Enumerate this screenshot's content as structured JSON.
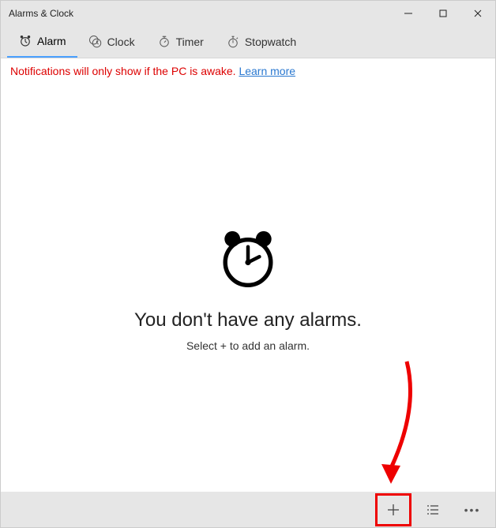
{
  "titlebar": {
    "title": "Alarms & Clock"
  },
  "tabs": [
    {
      "label": "Alarm",
      "icon": "alarm-icon",
      "active": true
    },
    {
      "label": "Clock",
      "icon": "clock-icon",
      "active": false
    },
    {
      "label": "Timer",
      "icon": "timer-icon",
      "active": false
    },
    {
      "label": "Stopwatch",
      "icon": "stopwatch-icon",
      "active": false
    }
  ],
  "notification": {
    "message": "Notifications will only show if the PC is awake. ",
    "link_label": "Learn more"
  },
  "empty_state": {
    "heading": "You don't have any alarms.",
    "subtext": "Select + to add an alarm."
  },
  "command_bar": {
    "add": {
      "label": "Add",
      "glyph": "+"
    },
    "select": {
      "label": "Select",
      "glyph": "select"
    },
    "more": {
      "label": "More",
      "glyph": "···"
    }
  },
  "annotation": {
    "highlight": "add",
    "arrow_color": "#e00"
  }
}
